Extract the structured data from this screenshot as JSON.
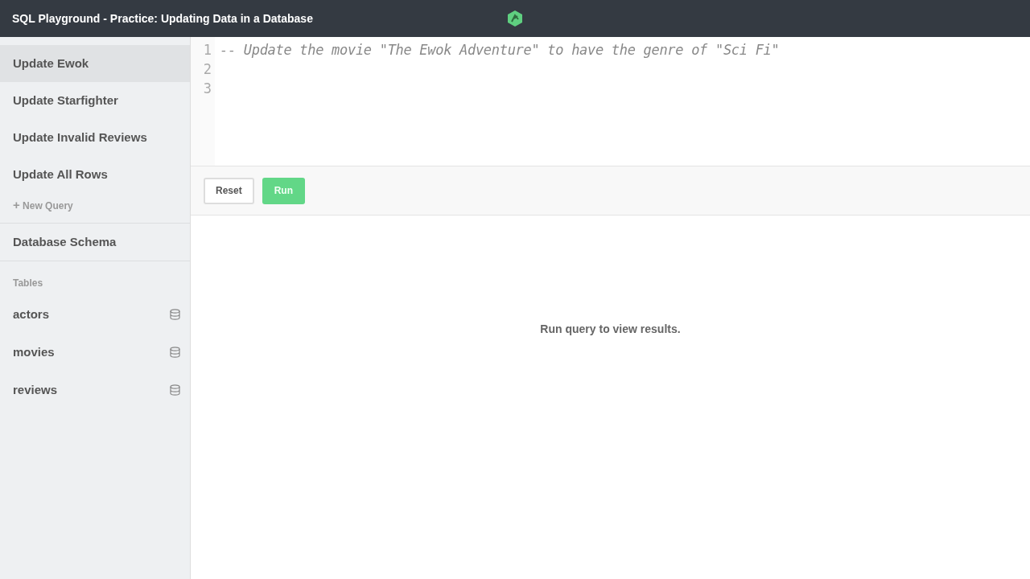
{
  "window": {
    "title": "SQL Playground - Practice: Updating Data in a Database"
  },
  "sidebar": {
    "queries": [
      {
        "label": "Update Ewok",
        "selected": true
      },
      {
        "label": "Update Starfighter",
        "selected": false
      },
      {
        "label": "Update Invalid Reviews",
        "selected": false
      },
      {
        "label": "Update All Rows",
        "selected": false
      }
    ],
    "new_query": {
      "icon": "+",
      "label": "New Query"
    },
    "schema": "Database Schema",
    "tables_heading": "Tables",
    "tables": [
      "actors",
      "movies",
      "reviews"
    ]
  },
  "editor": {
    "lines": [
      {
        "number": "1",
        "code": "-- Update the movie \"The Ewok Adventure\" to have the genre of \"Sci Fi\""
      },
      {
        "number": "2"
      },
      {
        "number": "3"
      }
    ]
  },
  "buttons": [
    {
      "label": "Reset",
      "kind": "secondary"
    },
    {
      "label": "Run",
      "kind": "primary"
    }
  ],
  "results": {
    "message": "Run query to view results."
  }
}
